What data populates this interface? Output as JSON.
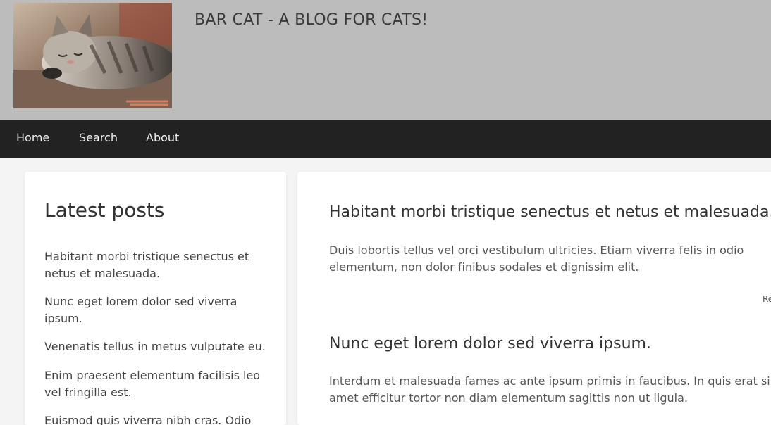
{
  "site": {
    "title": "BAR CAT - A BLOG FOR CATS!",
    "logo_alt": "sleeping kitten"
  },
  "nav": {
    "items": [
      {
        "label": "Home"
      },
      {
        "label": "Search"
      },
      {
        "label": "About"
      }
    ]
  },
  "sidebar": {
    "heading": "Latest posts",
    "items": [
      {
        "label": "Habitant morbi tristique senectus et netus et malesuada."
      },
      {
        "label": "Nunc eget lorem dolor sed viverra ipsum."
      },
      {
        "label": "Venenatis tellus in metus vulputate eu."
      },
      {
        "label": "Enim praesent elementum facilisis leo vel fringilla est."
      },
      {
        "label": "Euismod quis viverra nibh cras. Odio"
      }
    ]
  },
  "posts": [
    {
      "title": "Habitant morbi tristique senectus et netus et malesuada.",
      "excerpt": "Duis lobortis tellus vel orci vestibulum ultricies. Etiam viverra felis in odio elementum, non dolor finibus sodales et dignissim elit.",
      "read_more": "Read more"
    },
    {
      "title": "Nunc eget lorem dolor sed viverra ipsum.",
      "excerpt": "Interdum et malesuada fames ac ante ipsum primis in faucibus. In quis erat sit amet efficitur tortor non diam elementum sagittis non ut ligula."
    }
  ]
}
